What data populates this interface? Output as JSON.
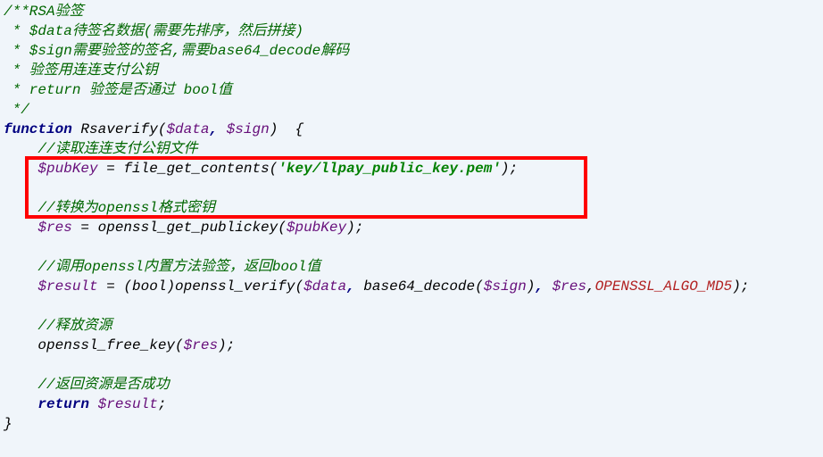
{
  "code": {
    "c1": "/**RSA验签",
    "c2": " * $data待签名数据(需要先排序，然后拼接)",
    "c3": " * $sign需要验签的签名,需要base64_decode解码",
    "c4": " * 验签用连连支付公钥",
    "c5": " * return 验签是否通过 bool值",
    "c6": " */",
    "kw_function": "function",
    "fn_name": "Rsaverify",
    "var_data": "$data",
    "var_sign": "$sign",
    "c7": "//读取连连支付公钥文件",
    "var_pubkey": "$pubKey",
    "fgc": "file_get_contents",
    "str_keypath": "'key/llpay_public_key.pem'",
    "c8": "//转换为openssl格式密钥",
    "var_res": "$res",
    "fn_getpk": "openssl_get_publickey",
    "c9": "//调用openssl内置方法验签，返回bool值",
    "var_result": "$result",
    "cast_bool": "bool",
    "fn_verify": "openssl_verify",
    "fn_b64d": "base64_decode",
    "const_algo": "OPENSSL_ALGO_MD5",
    "c10": "//释放资源",
    "fn_freekey": "openssl_free_key",
    "c11": "//返回资源是否成功",
    "kw_return": "return"
  }
}
